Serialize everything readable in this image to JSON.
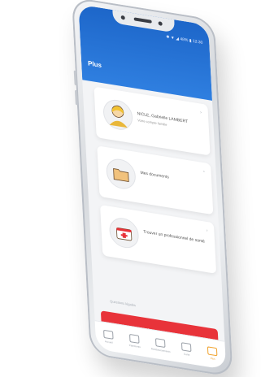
{
  "status_bar": {
    "text": "✱ ▼ ◢ 48% ▮ 12:30"
  },
  "header": {
    "title": "Plus"
  },
  "cards": [
    {
      "label": "NICLE, Gabrielle LAMBERT",
      "sublabel": "Votre compte famille",
      "icon": "user-avatar-icon"
    },
    {
      "label": "Mes documents",
      "sublabel": "",
      "icon": "folder-icon"
    },
    {
      "label": "Trouver un professionnel de santé",
      "sublabel": "",
      "icon": "medical-kit-icon"
    }
  ],
  "link_text": "Questions légales",
  "primary_button": {
    "label": "DÉCONNEXION"
  },
  "bottom_nav": [
    {
      "label": "Accueil",
      "icon": "home-icon"
    },
    {
      "label": "Paiements",
      "icon": "payments-icon"
    },
    {
      "label": "Remboursements",
      "icon": "refund-icon"
    },
    {
      "label": "Carte",
      "icon": "card-icon"
    },
    {
      "label": "Plus",
      "icon": "more-icon",
      "active": true
    }
  ],
  "colors": {
    "appbar": "#1d66c9",
    "primary_button": "#e8333a",
    "nav_active": "#f0a12b"
  }
}
